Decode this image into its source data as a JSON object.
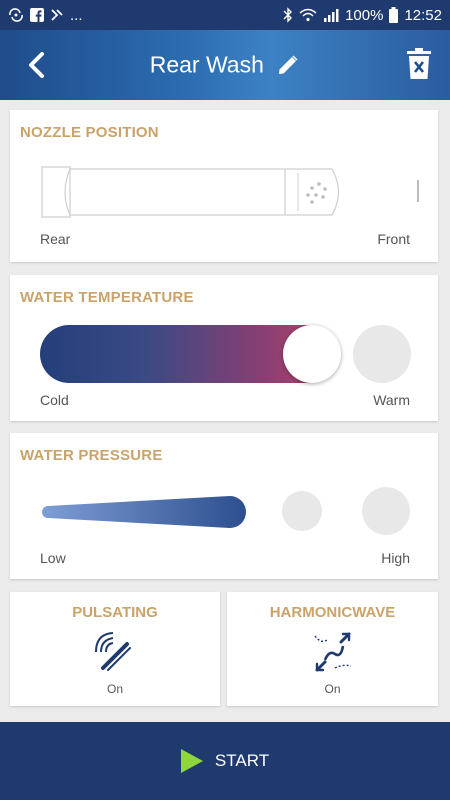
{
  "status_bar": {
    "battery": "100%",
    "time": "12:52",
    "overflow": "..."
  },
  "header": {
    "title": "Rear Wash"
  },
  "nozzle": {
    "title": "NOZZLE POSITION",
    "left_label": "Rear",
    "right_label": "Front"
  },
  "temperature": {
    "title": "WATER TEMPERATURE",
    "left_label": "Cold",
    "right_label": "Warm",
    "level": "2 of 3"
  },
  "pressure": {
    "title": "WATER PRESSURE",
    "left_label": "Low",
    "right_label": "High",
    "level": "1 of 3"
  },
  "pulsating": {
    "title": "PULSATING",
    "state": "On",
    "icon": "pulsating-icon"
  },
  "harmonicwave": {
    "title": "HARMONICWAVE",
    "state": "On",
    "icon": "harmonicwave-icon"
  },
  "start": {
    "label": "START"
  },
  "colors": {
    "navy": "#1e3a6e",
    "gold": "#c9a36a",
    "play_green": "#8fd63a"
  }
}
